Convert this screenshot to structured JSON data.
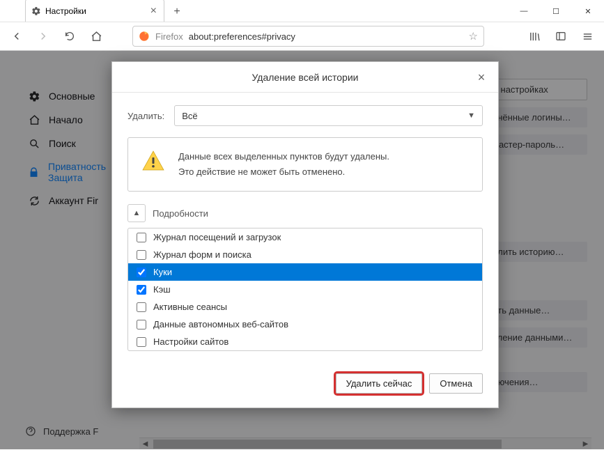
{
  "window": {
    "tab_title": "Настройки",
    "close_symbol": "×",
    "newtab_symbol": "+",
    "min_symbol": "—",
    "max_symbol": "☐",
    "winclose_symbol": "✕"
  },
  "toolbar": {
    "brand": "Firefox",
    "url": "about:preferences#privacy"
  },
  "sidebar": {
    "items": [
      {
        "label": "Основные",
        "icon": "gear"
      },
      {
        "label": "Начало",
        "icon": "home"
      },
      {
        "label": "Поиск",
        "icon": "search"
      },
      {
        "label": "Приватность Защита",
        "icon": "lock",
        "active": true
      },
      {
        "label": "Аккаунт Fir",
        "icon": "sync"
      }
    ],
    "support": "Поддержка F"
  },
  "page_buttons": {
    "search_placeholder": "в настройках",
    "saved_logins": "анённые логины…",
    "master_password": "мастер-пароль…",
    "delete_history": "алить историю…",
    "clear_data": "ить данные…",
    "manage_data": "вление данными…",
    "exceptions": "лючения…"
  },
  "dialog": {
    "title": "Удаление всей истории",
    "time_label": "Удалить:",
    "time_value": "Всё",
    "warning_line1": "Данные всех выделенных пунктов будут удалены.",
    "warning_line2": "Это действие не может быть отменено.",
    "details_label": "Подробности",
    "checks": [
      {
        "label": "Журнал посещений и загрузок",
        "checked": false,
        "selected": false
      },
      {
        "label": "Журнал форм и поиска",
        "checked": false,
        "selected": false
      },
      {
        "label": "Куки",
        "checked": true,
        "selected": true
      },
      {
        "label": "Кэш",
        "checked": true,
        "selected": false
      },
      {
        "label": "Активные сеансы",
        "checked": false,
        "selected": false
      },
      {
        "label": "Данные автономных веб-сайтов",
        "checked": false,
        "selected": false
      },
      {
        "label": "Настройки сайтов",
        "checked": false,
        "selected": false
      }
    ],
    "primary_btn": "Удалить сейчас",
    "cancel_btn": "Отмена"
  }
}
